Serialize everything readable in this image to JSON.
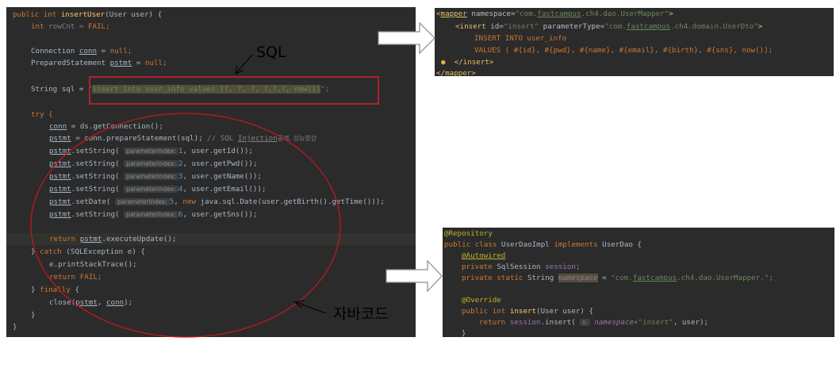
{
  "labels": {
    "sql": "SQL",
    "java_code": "자바코드"
  },
  "code": {
    "sig_mod": "public int ",
    "sig_name": "insertUser",
    "sig_rest": "(User user) {",
    "rowcnt_type": "int ",
    "rowcnt_rest": "rowCnt = ",
    "rowcnt_val": "FAIL",
    "conn_type": "Connection ",
    "conn_var": "conn",
    "eq": " = ",
    "null_kw": "null",
    "semi": ";",
    "ps_type": "PreparedStatement ",
    "ps_var": "pstmt",
    "sql_prefix": "String sql = ",
    "sql_quote": "\"",
    "sql_text": "insert into user_info values (?, ?, ?, ?,?,?, now())",
    "sql_end": "\";",
    "try_kw": "try {",
    "getconn_rest": "ds.getConnection();",
    "prep_rest": "conn.prepareStatement(sql);",
    "prep_c1": " // SQL ",
    "prep_c2": "Injection",
    "prep_c3": "공격, 성능향상",
    "set_method": ".setString( ",
    "setdate_method": ".setDate( ",
    "param_hint": "parameterIndex:",
    "idx1": "1",
    "idx2": "2",
    "idx3": "3",
    "idx4": "4",
    "idx5": "5",
    "idx6": "6",
    "arg1": ", user.getId());",
    "arg2": ", user.getPwd());",
    "arg3": ", user.getName());",
    "arg4": ", user.getEmail());",
    "arg5_sep": ", ",
    "arg5_new": "new ",
    "arg5_rest": "java.sql.Date(user.getBirth().getTime()));",
    "arg6": ", user.getSns());",
    "return_kw": "return ",
    "exec_rest": ".executeUpdate();",
    "catch_pre": "} ",
    "catch_kw": "catch",
    "catch_rest": " (SQLException e) {",
    "print_rest": "e.printStackTrace();",
    "fail": "FAIL",
    "finally_pre": "} ",
    "finally_kw": "finally",
    "finally_rest": " {",
    "close_pre": "close(",
    "close_sep": ", ",
    "close_end": ");",
    "close_brace": "}",
    "end_brace": "}"
  },
  "xml": {
    "mapper_open_lt": "<",
    "mapper_tag": "mapper",
    "ns_attr": " namespace=",
    "ns_val_a": "\"com.",
    "ns_val_b": "fastcampus",
    "ns_val_c": ".ch4.dao.UserMapper\"",
    "gt": ">",
    "insert_open": "<insert",
    "id_attr": " id=",
    "id_val": "\"insert\"",
    "ptype_attr": " parameterType=",
    "ptype_a": "\"com.",
    "ptype_b": "fastcampus",
    "ptype_c": ".ch4.domain.UserDto\"",
    "sql1": "INSERT INTO user_info",
    "sql2": "VALUES ( #{id}, #{pwd}, #{name}, #{email}, #{birth}, #{sns}, now());",
    "insert_close": "</insert>",
    "mapper_close": "</mapper>"
  },
  "impl": {
    "anno_repo": "@Repository",
    "class_kw": "public class ",
    "class_name": "UserDaoImpl ",
    "impl_kw": "implements ",
    "iface": "UserDao {",
    "anno_auto": "@Autowired",
    "priv_kw": "private ",
    "sess_type": "SqlSession ",
    "sess_var": "session",
    "semi": ";",
    "priv_static": "private static ",
    "str_type": "String ",
    "ns_var": "namespace",
    "ns_eq": " = ",
    "ns_val_a": "\"com.",
    "ns_val_b": "fastcampus",
    "ns_val_c": ".ch4.dao.UserMapper.\"",
    "anno_override": "@Override",
    "pub_int": "public int ",
    "insert_name": "insert",
    "insert_rest": "(User user) {",
    "ret_kw": "return ",
    "sess_call": "session",
    "ins_call": ".insert( ",
    "hint_s": "s:",
    "plus_ns": " namespace",
    "plus_str": "+\"insert\"",
    "ret_end": ", user);",
    "close_brace": "}"
  }
}
